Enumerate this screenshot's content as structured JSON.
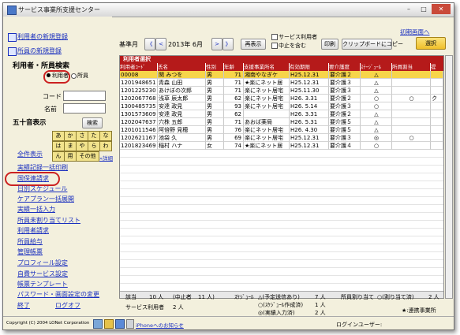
{
  "window": {
    "title": "サービス事業所支援センター",
    "min": "–",
    "max": "□",
    "close": "✕"
  },
  "sidebar": {
    "new_user": "利用者の新規登録",
    "new_office": "所員の新規登録",
    "search_title": "利用者・所員検索",
    "radio_user": "利用者",
    "radio_staff": "所員",
    "code_label": "コード",
    "name_label": "名前",
    "kana_title": "五十音表示",
    "search_btn": "検索",
    "kana": [
      "あ",
      "か",
      "さ",
      "た",
      "な",
      "は",
      "ま",
      "や",
      "ら",
      "わ",
      "ん",
      "用",
      "その他"
    ],
    "detail": "»詳細",
    "menu": [
      "全件表示",
      "実績記録一括印刷",
      "国保連請求",
      "日別スケジュール",
      "ケアプラン一括展開",
      "実績一括入力",
      "所員未割り当てリスト",
      "利用者請求",
      "所員給与",
      "管理帳票",
      "プロフィール設定",
      "自費サービス設定",
      "帳票テンプレート",
      "パスワード・画面設定の変更",
      "終了"
    ],
    "logoff": "ログオフ",
    "new_screen": "初期画面へ"
  },
  "toolbar": {
    "base_month_label": "基準月",
    "prev2": "《",
    "prev": "<",
    "month": "2013年 6月",
    "next": ">",
    "next2": "》",
    "redisplay": "再表示",
    "chk_service": "サービス利用者",
    "chk_pause": "中止を含む",
    "print": "印刷",
    "clipboard": "クリップボードにコピー",
    "select": "選択"
  },
  "grid": {
    "title": "利用者選択",
    "headers": [
      "利用者ｺｰﾄﾞ",
      "氏名",
      "性別",
      "年齢",
      "支援事業所名",
      "有効期限",
      "要介護度",
      "ｽﾃｰｼﾞｭｰﾙ",
      "所員割当",
      "提"
    ],
    "rows": [
      [
        "00008",
        "関 みつを",
        "男",
        "71",
        "湘南やなぎケ",
        "H25.12.31",
        "要介護２",
        "△",
        "",
        ""
      ],
      [
        "1201948651",
        "青森 山田",
        "男",
        "71",
        "★楽にネット居",
        "H25.12.31",
        "要介護３",
        "△",
        "",
        ""
      ],
      [
        "1201225230",
        "あけぼの次郎",
        "男",
        "71",
        "楽にネット居宅",
        "H25.11.30",
        "要介護３",
        "△",
        "",
        ""
      ],
      [
        "1202067768",
        "浅草 辰太郎",
        "男",
        "62",
        "楽にネット居宅",
        "H26. 3.31",
        "要介護２",
        "○",
        "○",
        "ク"
      ],
      [
        "1300485735",
        "安達 政見",
        "男",
        "93",
        "楽にネット居宅",
        "H26. 5.14",
        "要介護３",
        "○",
        "",
        ""
      ],
      [
        "1301573609",
        "安達 政見",
        "男",
        "62",
        "",
        "H26. 3.31",
        "要介護２",
        "△",
        "",
        ""
      ],
      [
        "1202047637",
        "穴株 五郎",
        "男",
        "71",
        "あおば薬局",
        "H26. 5.31",
        "要介護５",
        "△",
        "",
        ""
      ],
      [
        "1201011546",
        "阿倍野 見穂",
        "男",
        "76",
        "楽にネット居宅",
        "H26. 4.30",
        "要介護５",
        "△",
        "",
        ""
      ],
      [
        "1202621167",
        "池袋 久",
        "男",
        "69",
        "楽にネット居宅",
        "H25.12.31",
        "要介護３",
        "◎",
        "○",
        ""
      ],
      [
        "1201823469",
        "稲村 ハナ",
        "女",
        "74",
        "★楽にネット居",
        "H25.12.31",
        "要介護４",
        "○",
        "",
        ""
      ]
    ]
  },
  "summary": {
    "count_label": "該当",
    "count_value": "10 人",
    "paused_label": "(中止者",
    "paused_value": "11 人)",
    "schedule_label": "ｽｹｼﾞｭｰﾙ",
    "sched1_label": "△(予定送信あり)",
    "sched1_value": "7 人",
    "sched2_label": "○(ｽｹｼﾞｭｰﾙ作成済)",
    "sched2_value": "1 人",
    "sched3_label": "◎(実績入力済)",
    "sched3_value": "2 人",
    "assign_label": "所員割り当て",
    "assign_value": "○(割り当て済)",
    "assign_count": "2 人",
    "service_users_label": "サービス利用者",
    "service_users_value": "2 人",
    "legend_star": "★:連携事業所"
  },
  "status": {
    "copyright": "Copyright (C) 2004 LONet Corporation",
    "iphone": "iPhoneへのお知らせ",
    "login_user": "ログインユーザー:"
  },
  "accent": {
    "header": "#b51a1a",
    "link": "#1a2fbf",
    "kana": "#f2e38c",
    "highlight": "#f7d54a",
    "circle": "#cc2020"
  }
}
